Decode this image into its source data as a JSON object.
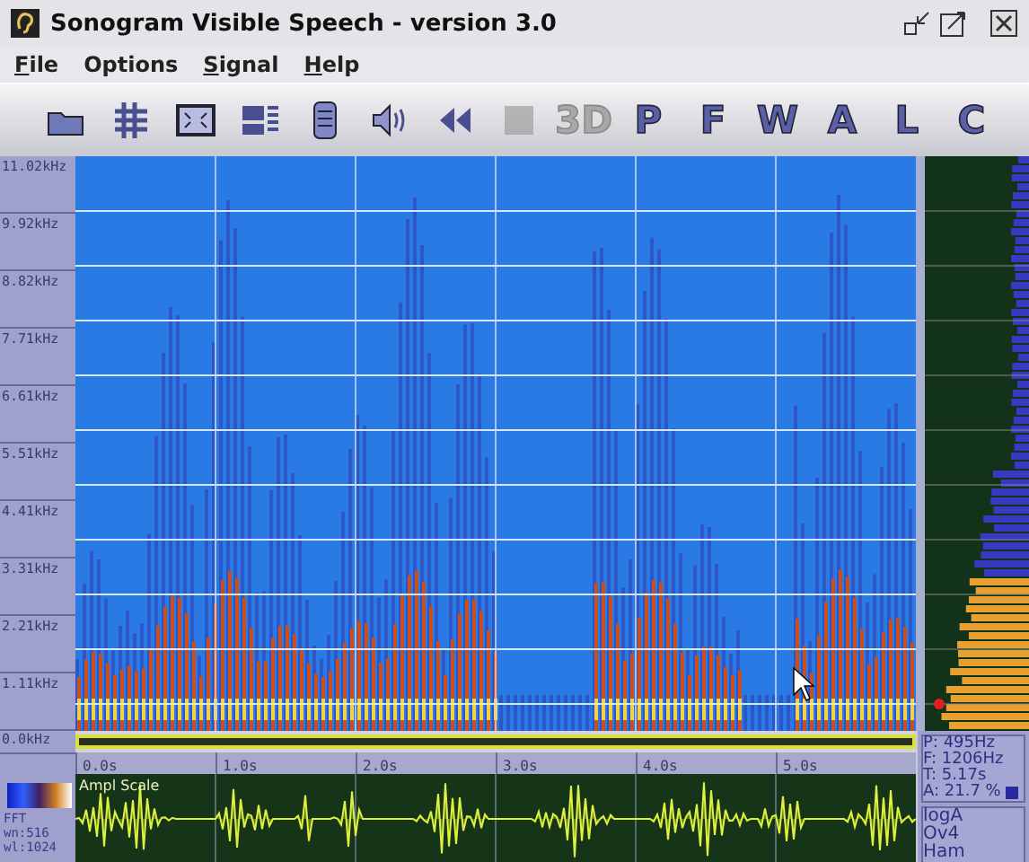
{
  "window": {
    "title": "Sonogram Visible Speech - version 3.0"
  },
  "menu": [
    {
      "label": "File",
      "underlined": true
    },
    {
      "label": "Options",
      "underlined": false
    },
    {
      "label": "Signal",
      "underlined": true
    },
    {
      "label": "Help",
      "underlined": true
    }
  ],
  "toolbar": [
    {
      "kind": "open",
      "disabled": false
    },
    {
      "kind": "grid",
      "disabled": false
    },
    {
      "kind": "fit",
      "disabled": false
    },
    {
      "kind": "panels",
      "disabled": false
    },
    {
      "kind": "scroll",
      "disabled": false
    },
    {
      "kind": "speaker",
      "disabled": false
    },
    {
      "kind": "rewind",
      "disabled": false
    },
    {
      "kind": "stop",
      "disabled": true
    },
    {
      "kind": "letter",
      "label": "3D",
      "disabled": true
    },
    {
      "kind": "letter",
      "label": "P",
      "disabled": false
    },
    {
      "kind": "letter",
      "label": "F",
      "disabled": false
    },
    {
      "kind": "letter",
      "label": "W",
      "disabled": false
    },
    {
      "kind": "letter",
      "label": "A",
      "disabled": false
    },
    {
      "kind": "letter",
      "label": "L",
      "disabled": false
    },
    {
      "kind": "letter",
      "label": "C",
      "disabled": false
    }
  ],
  "frequency_axis": [
    "11.02kHz",
    "9.92kHz",
    "8.82kHz",
    "7.71kHz",
    "6.61kHz",
    "5.51kHz",
    "4.41kHz",
    "3.31kHz",
    "2.21kHz",
    "1.11kHz",
    "0.0kHz"
  ],
  "time_axis": [
    "0.0s",
    "1.0s",
    "2.0s",
    "3.0s",
    "4.0s",
    "5.0s"
  ],
  "waveform": {
    "label": "Ampl Scale"
  },
  "fft": {
    "title": "FFT",
    "lines": [
      "wn:516",
      "wl:1024"
    ]
  },
  "readout": [
    "P: 495Hz",
    "F: 1206Hz",
    "T: 5.17s",
    "A: 21.7 %"
  ],
  "settings": [
    "logA",
    "Ov4",
    "Ham"
  ]
}
